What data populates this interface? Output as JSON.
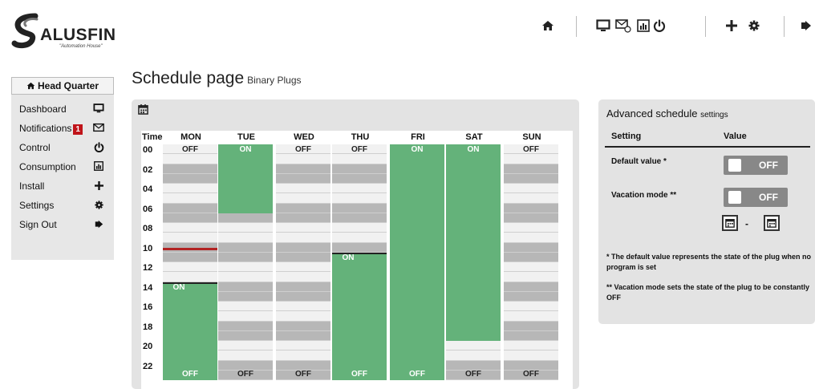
{
  "brand": {
    "name": "ALUSFIN",
    "tagline": "\"Automation House\""
  },
  "topbar": {
    "icons": [
      "home-icon",
      "desktop-icon",
      "mail-icon",
      "chart-icon",
      "power-icon",
      "plus-icon",
      "gear-icon",
      "sign-out-icon"
    ]
  },
  "sidebar": {
    "head": "Head Quarter",
    "items": [
      {
        "label": "Dashboard",
        "icon": "desktop-icon"
      },
      {
        "label": "Notifications",
        "badge": "1",
        "icon": "mail-icon"
      },
      {
        "label": "Control",
        "icon": "power-icon"
      },
      {
        "label": "Consumption",
        "icon": "chart-icon"
      },
      {
        "label": "Install",
        "icon": "plus-icon"
      },
      {
        "label": "Settings",
        "icon": "gear-icon"
      },
      {
        "label": "Sign Out",
        "icon": "sign-out-icon"
      }
    ]
  },
  "page": {
    "title": "Schedule page",
    "subtitle": "Binary Plugs"
  },
  "schedule": {
    "time_header": "Time",
    "days": [
      "MON",
      "TUE",
      "WED",
      "THU",
      "FRI",
      "SAT",
      "SUN"
    ],
    "rows": [
      "00",
      "02",
      "04",
      "06",
      "08",
      "10",
      "12",
      "14",
      "16",
      "18",
      "20",
      "22"
    ],
    "top_labels": [
      "OFF",
      "ON",
      "OFF",
      "OFF",
      "ON",
      "ON",
      "OFF"
    ],
    "bottom_labels": [
      "OFF",
      "OFF",
      "OFF",
      "OFF",
      "OFF",
      "OFF",
      "OFF"
    ],
    "on_periods": [
      {
        "day": "MON",
        "from": 14,
        "to": 24,
        "label": "ON"
      },
      {
        "day": "TUE",
        "from": 0,
        "to": 7,
        "label": "ON"
      },
      {
        "day": "THU",
        "from": 11,
        "to": 24,
        "label": "ON"
      },
      {
        "day": "FRI",
        "from": 0,
        "to": 24,
        "label": "ON"
      },
      {
        "day": "SAT",
        "from": 0,
        "to": 20,
        "label": "ON"
      }
    ],
    "current_time_marker": {
      "day": "MON",
      "hour": 10.5,
      "color": "#b22222"
    },
    "colors": {
      "on": "#64b27a",
      "band_gray": "#b7b7b7",
      "band_light": "#f1f1f1"
    }
  },
  "advanced": {
    "title": "Advanced schedule",
    "title_suffix": "settings",
    "col_setting": "Setting",
    "col_value": "Value",
    "default_label": "Default value *",
    "default_state": "OFF",
    "vacation_label": "Vacation mode **",
    "vacation_state": "OFF",
    "date_separator": "-",
    "note1": "* The default value represents the state of the plug when no program is set",
    "note2": "** Vacation mode sets the state of the plug to be constantly OFF"
  }
}
